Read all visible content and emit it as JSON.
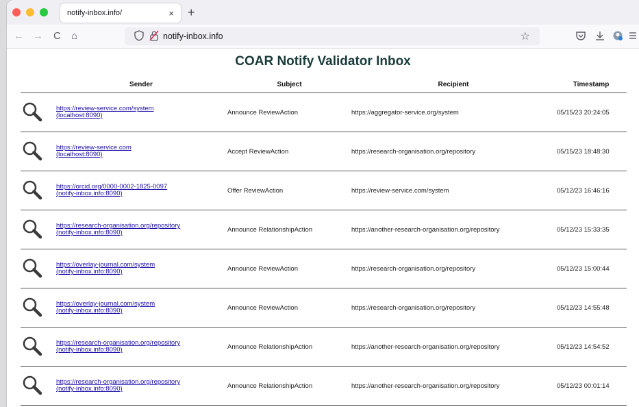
{
  "browser": {
    "tab_title": "notify-inbox.info/",
    "tab_close": "×",
    "new_tab": "+",
    "url": "notify-inbox.info",
    "back": "←",
    "forward": "→",
    "reload": "C",
    "home": "⌂",
    "star": "☆"
  },
  "page": {
    "title": "COAR Notify Validator Inbox"
  },
  "table": {
    "headers": {
      "sender": "Sender",
      "subject": "Subject",
      "recipient": "Recipient",
      "timestamp": "Timestamp"
    },
    "rows": [
      {
        "sender_url": "https://review-service.com/system",
        "sender_host": "(localhost:8090)",
        "subject": "Announce ReviewAction",
        "recipient": "https://aggregator-service.org/system",
        "timestamp": "05/15/23 20:24:05"
      },
      {
        "sender_url": "https://review-service.com",
        "sender_host": "(localhost:8090)",
        "subject": "Accept ReviewAction",
        "recipient": "https://research-organisation.org/repository",
        "timestamp": "05/15/23 18:48:30"
      },
      {
        "sender_url": "https://orcid.org/0000-0002-1825-0097",
        "sender_host": "(notify-inbox.info:8090)",
        "subject": "Offer ReviewAction",
        "recipient": "https://review-service.com/system",
        "timestamp": "05/12/23 16:46:16"
      },
      {
        "sender_url": "https://research-organisation.org/repository",
        "sender_host": "(notify-inbox.info:8090)",
        "subject": "Announce RelationshipAction",
        "recipient": "https://another-research-organisation.org/repository",
        "timestamp": "05/12/23 15:33:35"
      },
      {
        "sender_url": "https://overlay-journal.com/system",
        "sender_host": "(notify-inbox.info:8090)",
        "subject": "Announce ReviewAction",
        "recipient": "https://research-organisation.org/repository",
        "timestamp": "05/12/23 15:00:44"
      },
      {
        "sender_url": "https://overlay-journal.com/system",
        "sender_host": "(notify-inbox.info:8090)",
        "subject": "Announce ReviewAction",
        "recipient": "https://research-organisation.org/repository",
        "timestamp": "05/12/23 14:55:48"
      },
      {
        "sender_url": "https://research-organisation.org/repository",
        "sender_host": "(notify-inbox.info:8090)",
        "subject": "Announce RelationshipAction",
        "recipient": "https://another-research-organisation.org/repository",
        "timestamp": "05/12/23 14:54:52"
      },
      {
        "sender_url": "https://research-organisation.org/repository",
        "sender_host": "(notify-inbox.info:8090)",
        "subject": "Announce RelationshipAction",
        "recipient": "https://another-research-organisation.org/repository",
        "timestamp": "05/12/23 00:01:14"
      }
    ]
  },
  "colors": {
    "traffic_red": "#ff5f57",
    "traffic_yellow": "#febc2e",
    "traffic_green": "#28c840",
    "link": "#1a0dab",
    "title": "#1a3a3a"
  }
}
